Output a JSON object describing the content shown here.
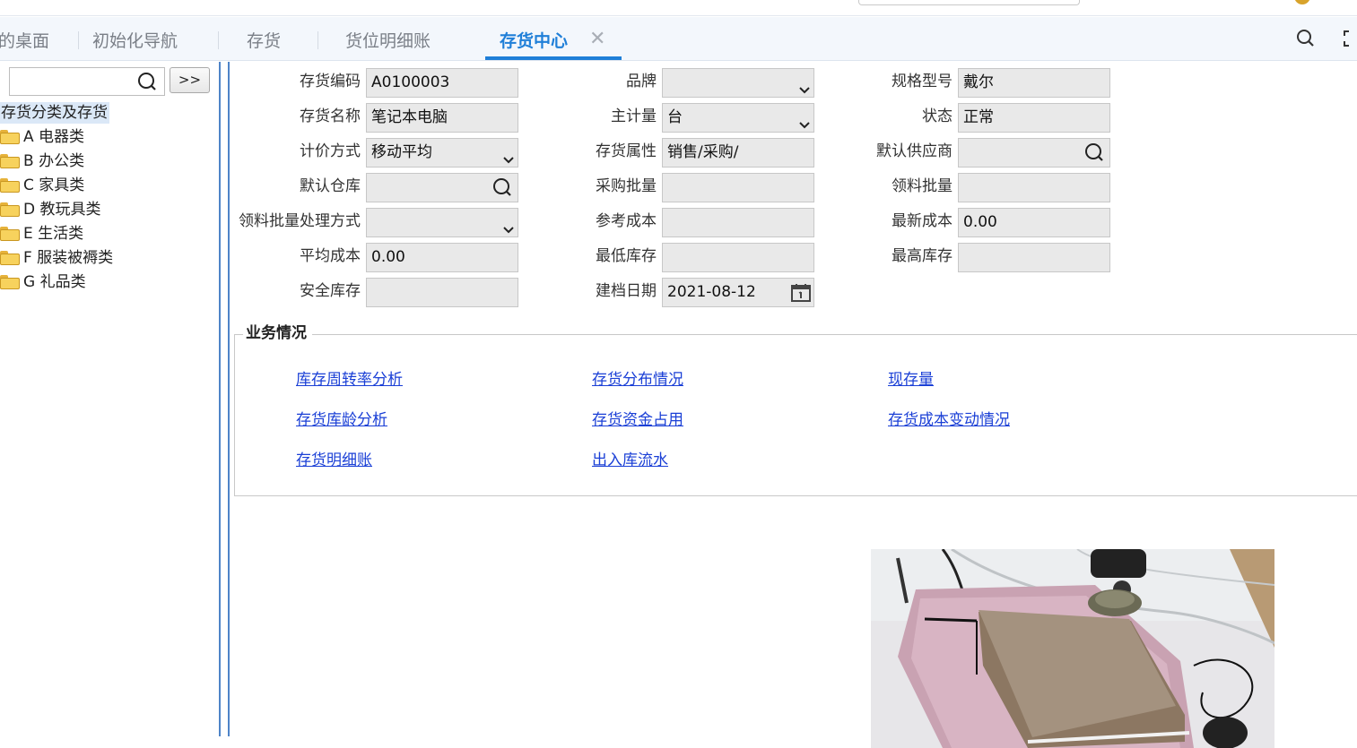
{
  "tabs": [
    {
      "label": "的桌面"
    },
    {
      "label": "初始化导航"
    },
    {
      "label": "存货"
    },
    {
      "label": "货位明细账"
    },
    {
      "label": "存货中心",
      "active": true
    }
  ],
  "toolbar_icons": [
    "search-icon",
    "fullscreen-icon"
  ],
  "sidebar": {
    "search_value": "",
    "go_button": ">>",
    "root_label": "存货分类及存货",
    "items": [
      {
        "label": "A 电器类"
      },
      {
        "label": "B 办公类"
      },
      {
        "label": "C 家具类"
      },
      {
        "label": "D 教玩具类"
      },
      {
        "label": "E 生活类"
      },
      {
        "label": "F 服装被褥类"
      },
      {
        "label": "G 礼品类"
      }
    ]
  },
  "form": {
    "code_label": "存货编码",
    "code_value": "A0100003",
    "brand_label": "品牌",
    "brand_value": "",
    "spec_label": "规格型号",
    "spec_value": "戴尔",
    "name_label": "存货名称",
    "name_value": "笔记本电脑",
    "unit_label": "主计量",
    "unit_value": "台",
    "status_label": "状态",
    "status_value": "正常",
    "pricing_label": "计价方式",
    "pricing_value": "移动平均",
    "attr_label": "存货属性",
    "attr_value": "销售/采购/",
    "supplier_label": "默认供应商",
    "supplier_value": "",
    "warehouse_label": "默认仓库",
    "warehouse_value": "",
    "purchase_batch_label": "采购批量",
    "purchase_batch_value": "",
    "pick_batch_label": "领料批量",
    "pick_batch_value": "",
    "pick_method_label": "领料批量处理方式",
    "pick_method_value": "",
    "ref_cost_label": "参考成本",
    "ref_cost_value": "",
    "latest_cost_label": "最新成本",
    "latest_cost_value": "0.00",
    "avg_cost_label": "平均成本",
    "avg_cost_value": "0.00",
    "min_stock_label": "最低库存",
    "min_stock_value": "",
    "max_stock_label": "最高库存",
    "max_stock_value": "",
    "safety_stock_label": "安全库存",
    "safety_stock_value": "",
    "created_label": "建档日期",
    "created_value": "2021-08-12"
  },
  "business": {
    "title": "业务情况",
    "links": [
      "库存周转率分析",
      "存货分布情况",
      "现存量",
      "存货库龄分析",
      "存货资金占用",
      "存货成本变动情况",
      "存货明细账",
      "出入库流水"
    ]
  },
  "colors": {
    "accent": "#1f7fd8",
    "link": "#1a3fd6",
    "splitter": "#4f84c8",
    "field_bg": "#e9e9e9"
  }
}
